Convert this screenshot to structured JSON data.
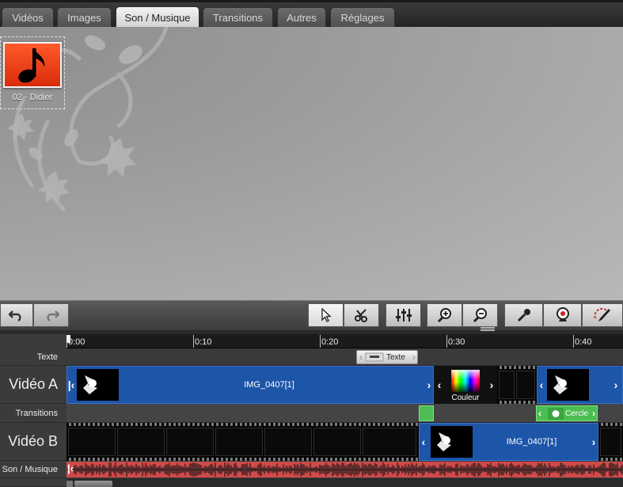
{
  "tabs": [
    {
      "label": "Vidéos",
      "active": false
    },
    {
      "label": "Images",
      "active": false
    },
    {
      "label": "Son / Musique",
      "active": true
    },
    {
      "label": "Transitions",
      "active": false
    },
    {
      "label": "Autres",
      "active": false
    },
    {
      "label": "Réglages",
      "active": false
    }
  ],
  "library": {
    "items": [
      {
        "label": "02 - Didier",
        "icon": "music-note-icon",
        "color": "#e3340f"
      }
    ]
  },
  "toolbar": {
    "buttons": [
      "undo-icon",
      "redo-icon",
      "select-pointer-icon",
      "split-scissors-icon",
      "audio-mixer-icon",
      "zoom-in-icon",
      "zoom-out-icon",
      "microphone-icon",
      "webcam-icon",
      "effects-brush-icon"
    ]
  },
  "timeline": {
    "ruler": [
      "0:00",
      "0:10",
      "0:20",
      "0:30",
      "0:40"
    ],
    "tracks": {
      "texte": "Texte",
      "video_a": "Vidéo A",
      "transitions": "Transitions",
      "video_b": "Vidéo B",
      "son": "Son / Musique"
    },
    "clips": {
      "text_clip": "Texte",
      "video_a_clip": "IMG_0407[1]",
      "color_clip": "Couleur",
      "transition_clip": "Cercle",
      "video_b_clip": "IMG_0407[1]"
    }
  },
  "colors": {
    "clip_blue": "#1d55a8",
    "transition_green": "#4cbd52",
    "audio_red": "#d04a4a",
    "active_tab": "#e6e6e6"
  }
}
